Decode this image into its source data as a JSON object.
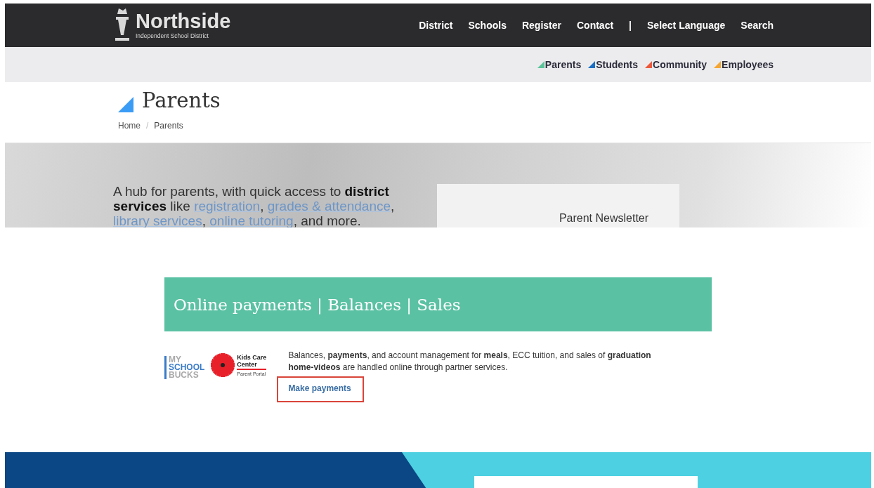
{
  "header": {
    "logo_name": "Northside",
    "logo_subtitle": "Independent School District",
    "nav_main": [
      "District",
      "Schools",
      "Register",
      "Contact"
    ],
    "nav_separator": "|",
    "nav_tools": [
      "Select Language",
      "Search"
    ]
  },
  "audiences": [
    {
      "label": "Parents",
      "color": "#5cc49a"
    },
    {
      "label": "Students",
      "color": "#1a6fc4"
    },
    {
      "label": "Community",
      "color": "#ec5a3c"
    },
    {
      "label": "Employees",
      "color": "#f5a632"
    }
  ],
  "page_title": {
    "text": "Parents",
    "color": "#3b9cf5"
  },
  "breadcrumb_separator": "/",
  "breadcrumbs": [
    {
      "label": "Home",
      "selected": false
    },
    {
      "label": "Parents",
      "selected": true
    }
  ],
  "hero": {
    "segments": [
      {
        "text": "A hub for parents, with quick access to ",
        "kind": "plain"
      },
      {
        "text": "district services",
        "kind": "bold"
      },
      {
        "text": " like ",
        "kind": "plain"
      },
      {
        "text": "registration",
        "kind": "link"
      },
      {
        "text": ", ",
        "kind": "plain"
      },
      {
        "text": "grades & attendance",
        "kind": "link"
      },
      {
        "text": ", ",
        "kind": "plain"
      },
      {
        "text": "library services",
        "kind": "link"
      },
      {
        "text": ", ",
        "kind": "plain"
      },
      {
        "text": "online tutoring",
        "kind": "link"
      },
      {
        "text": ", and more.",
        "kind": "plain"
      }
    ],
    "card_title": "Parent Newsletter"
  },
  "payments": {
    "title": "Online payments | Balances | Sales",
    "logo_1": [
      "MY",
      "SCHOOL",
      "BUCKS"
    ],
    "logo_2": {
      "name_line_1": "Kids Care",
      "name_line_2": "Center",
      "subtitle": "Parent Portal"
    },
    "description": "Balances, **payments**, and account management for **meals**, ECC tuition, and sales of **graduation home-videos** are handled online through partner services.",
    "button": {
      "label": "Make payments",
      "highlighted": true
    }
  }
}
